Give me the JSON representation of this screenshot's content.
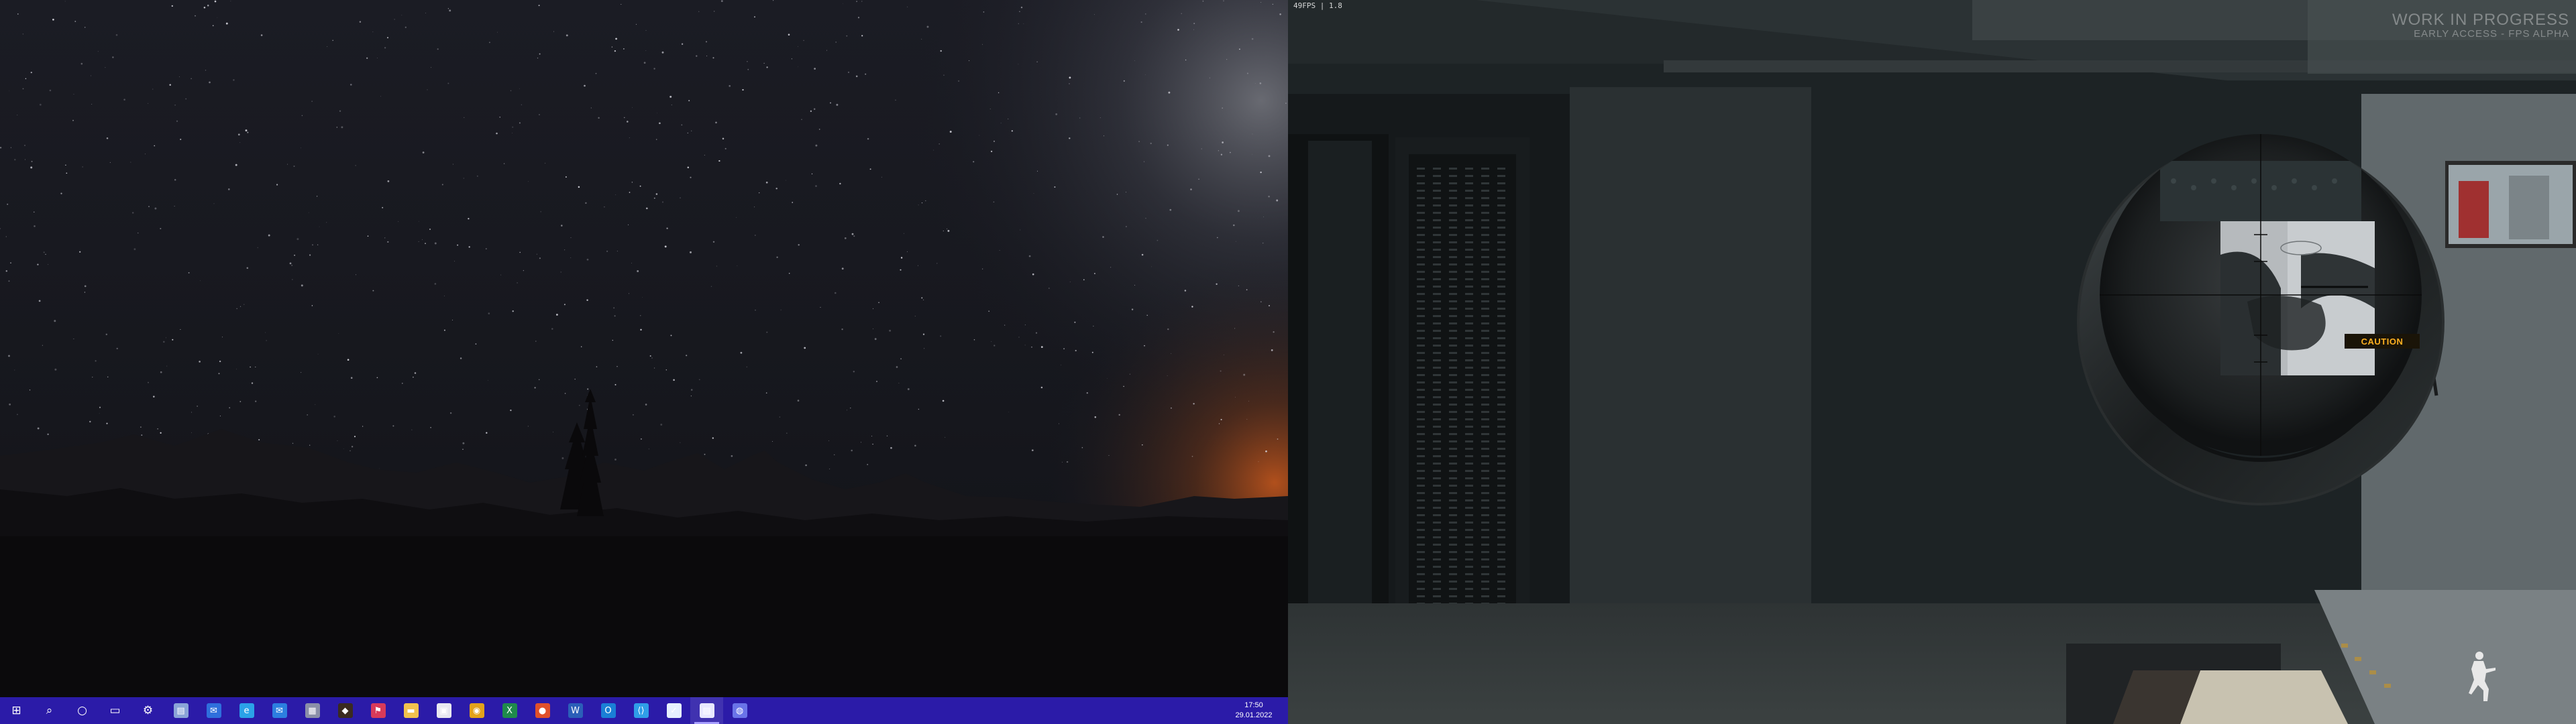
{
  "desktop": {
    "taskbar": {
      "apps": [
        {
          "name": "start-button",
          "glyph": "windows-icon",
          "color": "#ffffff",
          "active": false
        },
        {
          "name": "search-button",
          "glyph": "search-icon",
          "color": "#ffffff",
          "active": false
        },
        {
          "name": "cortana-button",
          "glyph": "circle-icon",
          "color": "#ffffff",
          "active": false
        },
        {
          "name": "task-view-button",
          "glyph": "task-view-icon",
          "color": "#ffffff",
          "active": false
        },
        {
          "name": "settings-app",
          "glyph": "gear-icon",
          "color": "#ffffff",
          "active": false
        },
        {
          "name": "file-explorer-app",
          "glyph": "folder-icon",
          "color": "#8aa4d8",
          "active": false
        },
        {
          "name": "mail-app",
          "glyph": "mail-icon",
          "color": "#2f6fdc",
          "active": false
        },
        {
          "name": "edge-app",
          "glyph": "edge-icon",
          "color": "#2ba2e8",
          "active": false
        },
        {
          "name": "mail-alt-app",
          "glyph": "envelope-icon",
          "color": "#2c7fe0",
          "active": false
        },
        {
          "name": "calculator-app",
          "glyph": "calculator-icon",
          "color": "#8a8fa8",
          "active": false
        },
        {
          "name": "game-launcher-app",
          "glyph": "game-icon",
          "color": "#3a2a20",
          "active": false
        },
        {
          "name": "flag-app",
          "glyph": "flag-icon",
          "color": "#d83a5a",
          "active": false
        },
        {
          "name": "explorer-folder-app",
          "glyph": "folder-yellow-icon",
          "color": "#f2c14e",
          "active": false
        },
        {
          "name": "store-app",
          "glyph": "store-icon",
          "color": "#e8e8f0",
          "active": false
        },
        {
          "name": "chrome-app",
          "glyph": "chrome-icon",
          "color": "#e3a21a",
          "active": false
        },
        {
          "name": "excel-app",
          "glyph": "excel-icon",
          "color": "#1f8a4c",
          "active": false
        },
        {
          "name": "browser-app",
          "glyph": "browser-icon",
          "color": "#e0502a",
          "active": false
        },
        {
          "name": "word-app",
          "glyph": "word-icon",
          "color": "#2b5fb8",
          "active": false
        },
        {
          "name": "outlook-app",
          "glyph": "outlook-icon",
          "color": "#1a7fd6",
          "active": false
        },
        {
          "name": "vscode-app",
          "glyph": "vscode-icon",
          "color": "#2f9ee8",
          "active": false
        },
        {
          "name": "steam-app",
          "glyph": "steam-icon",
          "color": "#e6f0ff",
          "active": false
        },
        {
          "name": "game-window-app",
          "glyph": "window-icon",
          "color": "#e8e8ff",
          "active": true
        },
        {
          "name": "discord-app",
          "glyph": "discord-icon",
          "color": "#6a74e8",
          "active": false
        }
      ],
      "clock": {
        "time": "17:50",
        "date": "29.01.2022"
      }
    }
  },
  "game": {
    "fps_text": "49FPS | 1.8",
    "watermark_title": "WORK IN PROGRESS",
    "watermark_subtitle": "EARLY ACCESS - FPS ALPHA",
    "caution_sign": "CAUTION"
  }
}
